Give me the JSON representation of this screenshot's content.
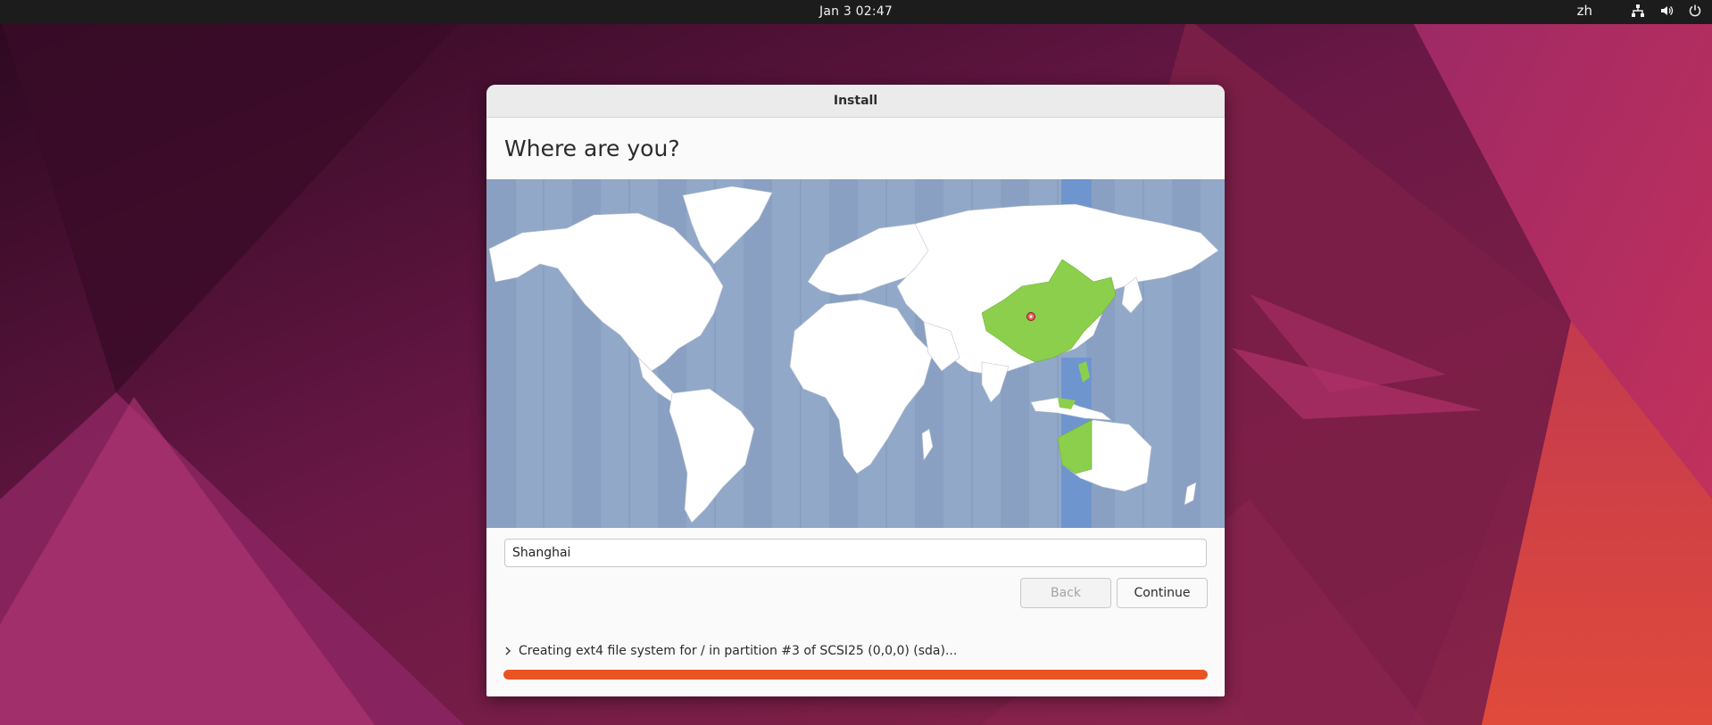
{
  "topbar": {
    "datetime": "Jan 3  02:47",
    "language": "zh",
    "icons": [
      "network-icon",
      "volume-icon",
      "power-icon"
    ]
  },
  "window": {
    "title": "Install",
    "heading": "Where are you?",
    "timezone_value": "Shanghai",
    "buttons": {
      "back": "Back",
      "continue": "Continue"
    },
    "status_text": "Creating ext4 file system for / in partition #3 of SCSI25 (0,0,0) (sda)...",
    "progress": 1.0
  },
  "colors": {
    "accent": "#e95420",
    "selected_region": "#8ccf4d",
    "timezone_band": "#6f95cf",
    "ocean": "#92a8c8"
  }
}
